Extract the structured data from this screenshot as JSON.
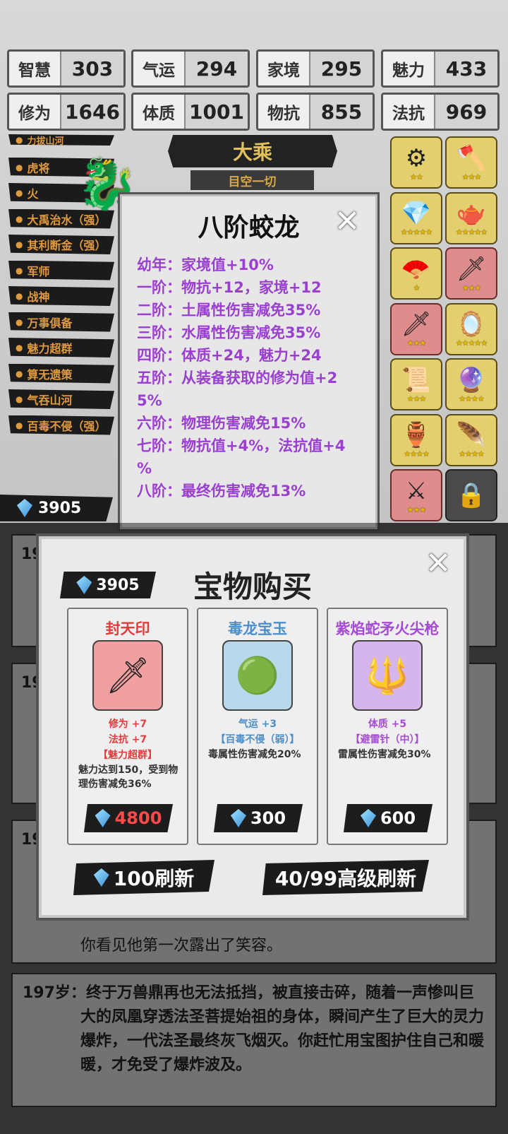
{
  "stats": [
    {
      "label": "智慧",
      "value": "303"
    },
    {
      "label": "气运",
      "value": "294"
    },
    {
      "label": "家境",
      "value": "295"
    },
    {
      "label": "魅力",
      "value": "433"
    },
    {
      "label": "修为",
      "value": "1646"
    },
    {
      "label": "体质",
      "value": "1001"
    },
    {
      "label": "物抗",
      "value": "855"
    },
    {
      "label": "法抗",
      "value": "969"
    }
  ],
  "abilities": [
    "力拔山河",
    "虎将",
    "火",
    "大禹治水（强）",
    "其利断金（强）",
    "军师",
    "战神",
    "万事俱备",
    "魅力超群",
    "算无遗策",
    "气吞山河",
    "百毒不侵（强）"
  ],
  "realm": {
    "title": "大乘",
    "subtitle": "目空一切"
  },
  "gems_top": "3905",
  "dragon": {
    "title": "八阶蛟龙",
    "tiers": [
      "幼年：家境值+10%",
      "一阶：物抗+12，家境+12",
      "二阶：土属性伤害减免35%",
      "三阶：水属性伤害减免35%",
      "四阶：体质+24，魅力+24",
      "五阶：从装备获取的修为值+2",
      "5%",
      "六阶：物理伤害减免15%",
      "七阶：物抗值+4%，法抗值+4",
      "%",
      "八阶：最终伤害减免13%"
    ]
  },
  "equipment": [
    {
      "icon": "⚙",
      "stars": "★★",
      "color": "gold"
    },
    {
      "icon": "🪓",
      "stars": "★★★",
      "color": "gold"
    },
    {
      "icon": "💎",
      "stars": "★★★★★",
      "color": "gold"
    },
    {
      "icon": "🫖",
      "stars": "★★★★★",
      "color": "gold"
    },
    {
      "icon": "🪭",
      "stars": "★",
      "color": "gold"
    },
    {
      "icon": "🗡",
      "stars": "★★★",
      "color": "red"
    },
    {
      "icon": "🗡",
      "stars": "★★★",
      "color": "red"
    },
    {
      "icon": "🪞",
      "stars": "★★★★★",
      "color": "gold"
    },
    {
      "icon": "📜",
      "stars": "★★★",
      "color": "gold"
    },
    {
      "icon": "🔮",
      "stars": "★★★★",
      "color": "gold"
    },
    {
      "icon": "🏺",
      "stars": "★★★★",
      "color": "gold"
    },
    {
      "icon": "🪶",
      "stars": "★★★★",
      "color": "gold"
    },
    {
      "icon": "⚔",
      "stars": "★★★",
      "color": "red"
    },
    {
      "icon": "🔒",
      "stars": "",
      "color": "lock"
    }
  ],
  "shop": {
    "title": "宝物购买",
    "gems": "3905",
    "items": [
      {
        "name": "封天印",
        "name_color": "#e23c3c",
        "icon": "🗡",
        "img_bg": "#f0a0a0",
        "stats": [
          "修为 +7",
          "法抗 +7"
        ],
        "stat_color": "#e23c3c",
        "skill": "【魅力超群】",
        "desc": "魅力达到150，受到物理伤害减免36%",
        "price": "4800",
        "price_color": "#ff4a4a"
      },
      {
        "name": "毒龙宝玉",
        "name_color": "#4b8ec9",
        "icon": "🟢",
        "img_bg": "#b9d7ea",
        "stats": [
          "气运 +3"
        ],
        "stat_color": "#4b8ec9",
        "skill": "【百毒不侵（弱）】",
        "desc": "毒属性伤害减免20%",
        "price": "300",
        "price_color": "#ffffff"
      },
      {
        "name": "紫焰蛇矛火尖枪",
        "name_color": "#a64ad6",
        "icon": "🔱",
        "img_bg": "#d6b4ec",
        "stats": [
          "体质 +5"
        ],
        "stat_color": "#a64ad6",
        "skill": "【避雷针（中）】",
        "desc": "雷属性伤害减免30%",
        "price": "600",
        "price_color": "#ffffff"
      }
    ],
    "refresh_label": "100刷新",
    "adv_refresh_label": "40/99高级刷新"
  },
  "logs": [
    {
      "age": "19",
      "text": ""
    },
    {
      "age": "19",
      "text": ""
    },
    {
      "age": "19",
      "text": ""
    },
    {
      "age": "",
      "text": "你看见他第一次露出了笑容。"
    },
    {
      "age": "197岁：",
      "text": "终于万兽鼎再也无法抵挡，被直接击碎，随着一声惨叫巨大的凤凰穿透法圣菩提始祖的身体，瞬间产生了巨大的灵力爆炸，一代法圣最终灰飞烟灭。你赶忙用宝图护住自己和暖暖，才免受了爆炸波及。"
    }
  ]
}
